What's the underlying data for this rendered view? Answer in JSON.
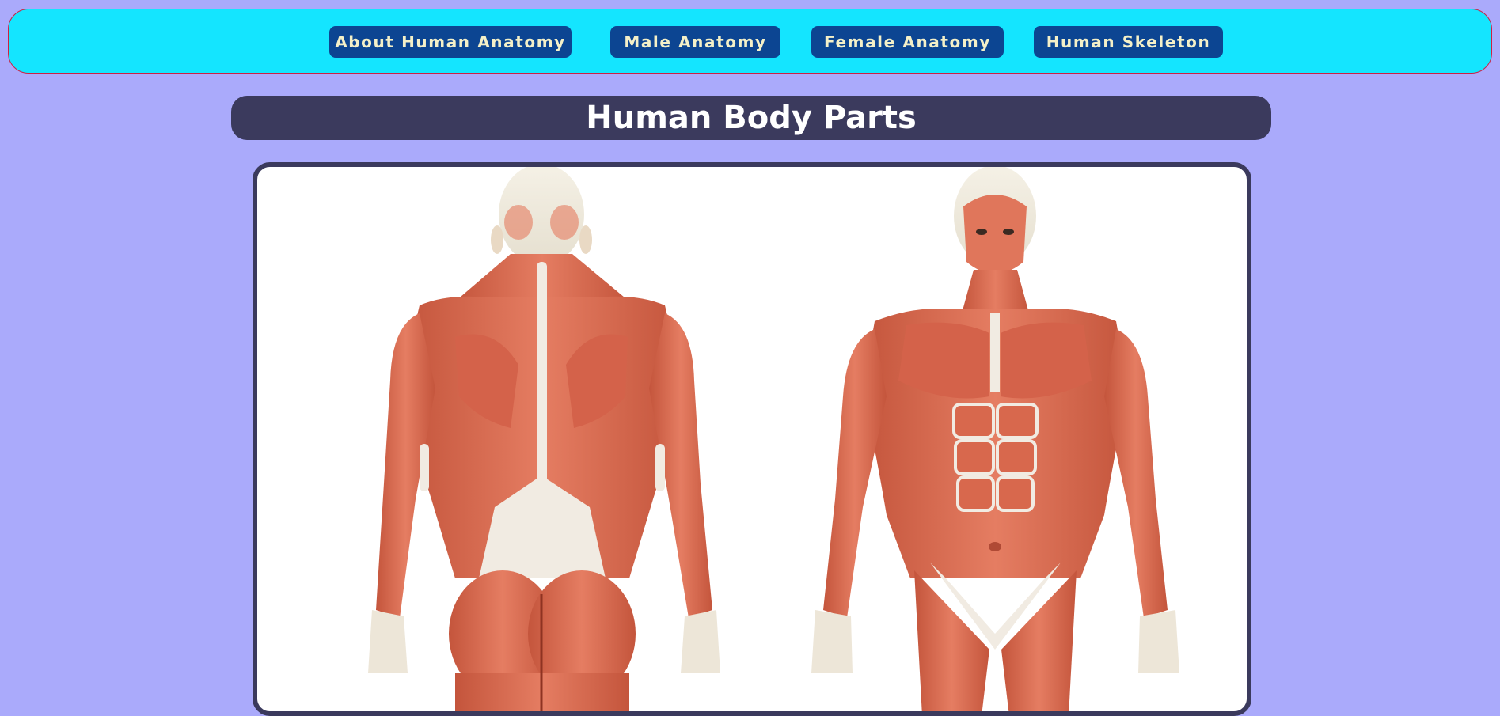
{
  "nav": {
    "items": [
      {
        "label": "About Human Anatomy"
      },
      {
        "label": "Male Anatomy"
      },
      {
        "label": "Female Anatomy"
      },
      {
        "label": "Human Skeleton"
      }
    ]
  },
  "page": {
    "title": "Human Body Parts"
  },
  "illustration": {
    "figures": [
      "back-view-muscle-figure",
      "front-view-muscle-figure"
    ]
  },
  "colors": {
    "background": "#aaaafb",
    "navbar_bg": "#14e5ff",
    "navbar_border": "#cc2244",
    "nav_button_bg": "#0c4592",
    "nav_button_text": "#f4f0c8",
    "title_bar_bg": "#3b3a5d",
    "title_text": "#ffffff",
    "muscle": "#d9694f",
    "tendon": "#f1ebe2"
  }
}
